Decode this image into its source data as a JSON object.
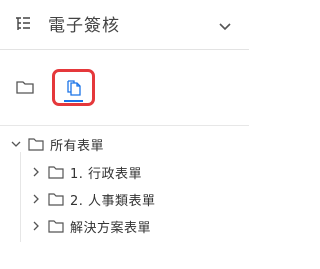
{
  "header": {
    "title": "電子簽核",
    "app_icon": "list-tree-icon",
    "expand_icon": "chevron-down-icon"
  },
  "toolbar": {
    "buttons": [
      {
        "icon": "folder-icon"
      },
      {
        "icon": "copy-documents-icon",
        "active": true
      }
    ],
    "highlight_color": "#e5383b",
    "active_color": "#1a73e8"
  },
  "tree": {
    "root": {
      "label": "所有表單",
      "expanded": true
    },
    "children": [
      {
        "label": "1. 行政表單"
      },
      {
        "label": "2. 人事類表單"
      },
      {
        "label": "解決方案表單"
      }
    ]
  }
}
